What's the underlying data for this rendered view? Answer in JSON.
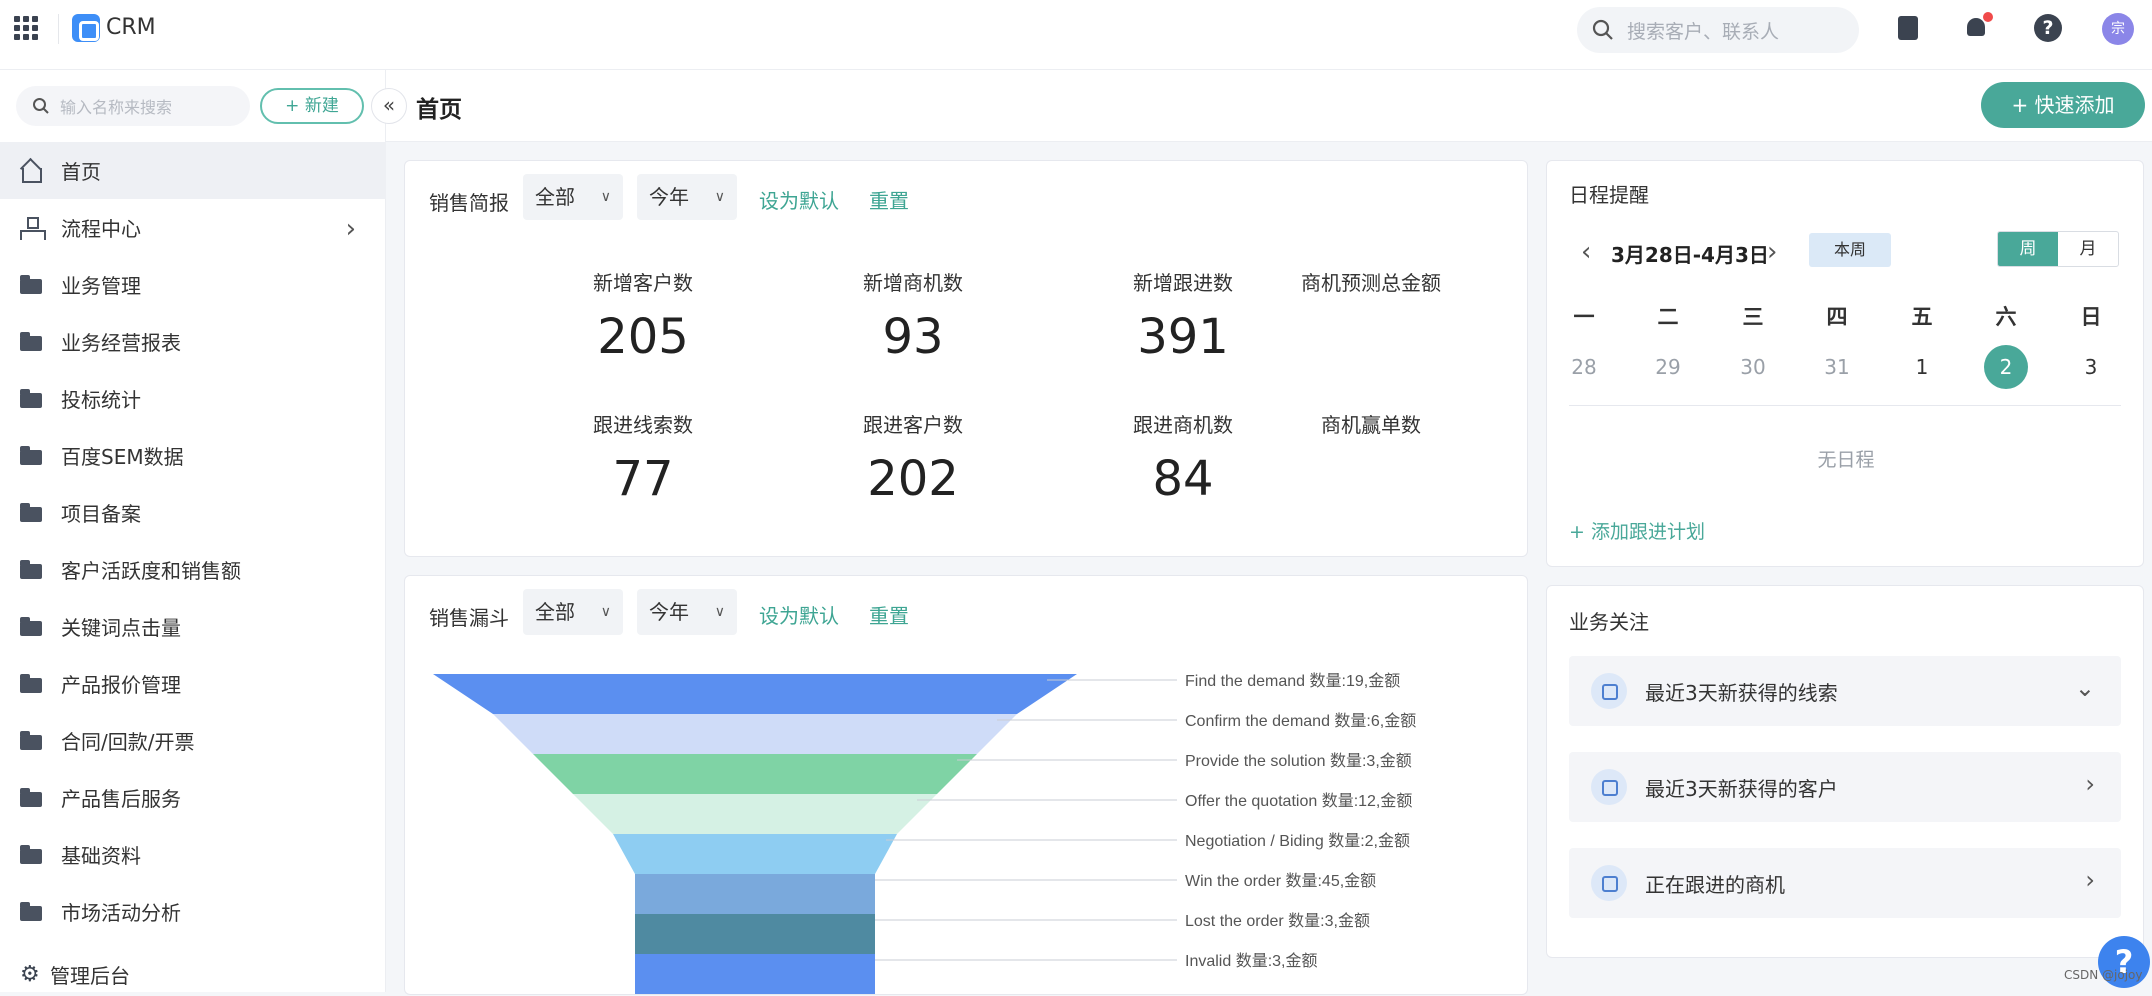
{
  "app": {
    "title": "CRM",
    "avatar_text": "宗"
  },
  "top_search": {
    "placeholder": "搜索客户、联系人"
  },
  "sidebar": {
    "search_placeholder": "输入名称来搜索",
    "new_label": "+ 新建",
    "collapse_glyph": "«",
    "items": [
      {
        "label": "首页",
        "icon": "home-icon"
      },
      {
        "label": "流程中心",
        "icon": "flow-icon"
      },
      {
        "label": "业务管理",
        "icon": "folder-icon"
      },
      {
        "label": "业务经营报表",
        "icon": "folder-icon"
      },
      {
        "label": "投标统计",
        "icon": "folder-icon"
      },
      {
        "label": "百度SEM数据",
        "icon": "folder-icon"
      },
      {
        "label": "项目备案",
        "icon": "folder-icon"
      },
      {
        "label": "客户活跃度和销售额",
        "icon": "folder-icon"
      },
      {
        "label": "关键词点击量",
        "icon": "folder-icon"
      },
      {
        "label": "产品报价管理",
        "icon": "folder-icon"
      },
      {
        "label": "合同/回款/开票",
        "icon": "folder-icon"
      },
      {
        "label": "产品售后服务",
        "icon": "folder-icon"
      },
      {
        "label": "基础资料",
        "icon": "folder-icon"
      },
      {
        "label": "市场活动分析",
        "icon": "folder-icon"
      }
    ],
    "admin_label": "管理后台"
  },
  "header": {
    "title": "首页",
    "quick_add": "+ 快速添加"
  },
  "sales_brief": {
    "title": "销售简报",
    "filter_scope": "全部",
    "filter_period": "今年",
    "set_default": "设为默认",
    "reset": "重置",
    "metrics": [
      {
        "label": "新增客户数",
        "value": "205"
      },
      {
        "label": "新增商机数",
        "value": "93"
      },
      {
        "label": "新增跟进数",
        "value": "391"
      },
      {
        "label": "商机预测总金额",
        "value": ""
      },
      {
        "label": "跟进线索数",
        "value": "77"
      },
      {
        "label": "跟进客户数",
        "value": "202"
      },
      {
        "label": "跟进商机数",
        "value": "84"
      },
      {
        "label": "商机赢单数",
        "value": ""
      }
    ]
  },
  "funnel": {
    "title": "销售漏斗",
    "filter_scope": "全部",
    "filter_period": "今年",
    "set_default": "设为默认",
    "reset": "重置",
    "colors": [
      "#5b8ff0",
      "#cfdcf8",
      "#7fd3a5",
      "#d5f1e4",
      "#8ecdf2",
      "#7aa9dc",
      "#4f8aa1",
      "#5b8ff0"
    ]
  },
  "chart_data": {
    "type": "funnel",
    "title": "销售漏斗",
    "stages": [
      {
        "name": "Find the demand",
        "count": 19,
        "label": "Find the demand 数量:19,金额"
      },
      {
        "name": "Confirm the demand",
        "count": 6,
        "label": "Confirm the demand 数量:6,金额"
      },
      {
        "name": "Provide the solution",
        "count": 3,
        "label": "Provide the solution 数量:3,金额"
      },
      {
        "name": "Offer the quotation",
        "count": 12,
        "label": "Offer the quotation 数量:12,金额"
      },
      {
        "name": "Negotiation / Biding",
        "count": 2,
        "label": "Negotiation / Biding 数量:2,金额"
      },
      {
        "name": "Win the order",
        "count": 45,
        "label": "Win the order 数量:45,金额"
      },
      {
        "name": "Lost the order",
        "count": 3,
        "label": "Lost the order 数量:3,金额"
      },
      {
        "name": "Invalid",
        "count": 3,
        "label": "Invalid 数量:3,金额"
      }
    ]
  },
  "schedule": {
    "title": "日程提醒",
    "range": "3月28日-4月3日",
    "this_week": "本周",
    "view_week": "周",
    "view_month": "月",
    "weekdays": [
      "一",
      "二",
      "三",
      "四",
      "五",
      "六",
      "日"
    ],
    "dates": [
      "28",
      "29",
      "30",
      "31",
      "1",
      "2",
      "3"
    ],
    "today_index": 5,
    "empty": "无日程",
    "add_plan": "+ 添加跟进计划"
  },
  "focus": {
    "title": "业务关注",
    "items": [
      {
        "label": "最近3天新获得的线索",
        "arrow": "⌄"
      },
      {
        "label": "最近3天新获得的客户",
        "arrow": "›"
      },
      {
        "label": "正在跟进的商机",
        "arrow": "›"
      }
    ]
  },
  "float_help": "?",
  "credit": "CSDN @jojoy"
}
